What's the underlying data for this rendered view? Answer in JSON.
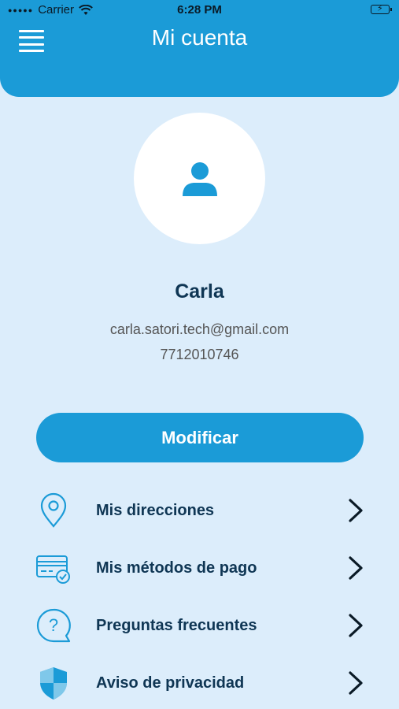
{
  "status_bar": {
    "carrier": "Carrier",
    "time": "6:28 PM"
  },
  "header": {
    "title": "Mi cuenta",
    "menu_icon": "hamburger-menu-icon"
  },
  "profile": {
    "name": "Carla",
    "email": "carla.satori.tech@gmail.com",
    "phone": "7712010746",
    "avatar_icon": "user-icon"
  },
  "actions": {
    "modify_label": "Modificar"
  },
  "menu": {
    "items": [
      {
        "label": "Mis direcciones",
        "icon": "location-pin-icon"
      },
      {
        "label": "Mis métodos de pago",
        "icon": "credit-card-icon"
      },
      {
        "label": "Preguntas frecuentes",
        "icon": "question-bubble-icon"
      },
      {
        "label": "Aviso de privacidad",
        "icon": "shield-icon"
      }
    ]
  },
  "colors": {
    "primary": "#1b9bd7",
    "background": "#dcedfb",
    "text_dark": "#0f3654"
  }
}
